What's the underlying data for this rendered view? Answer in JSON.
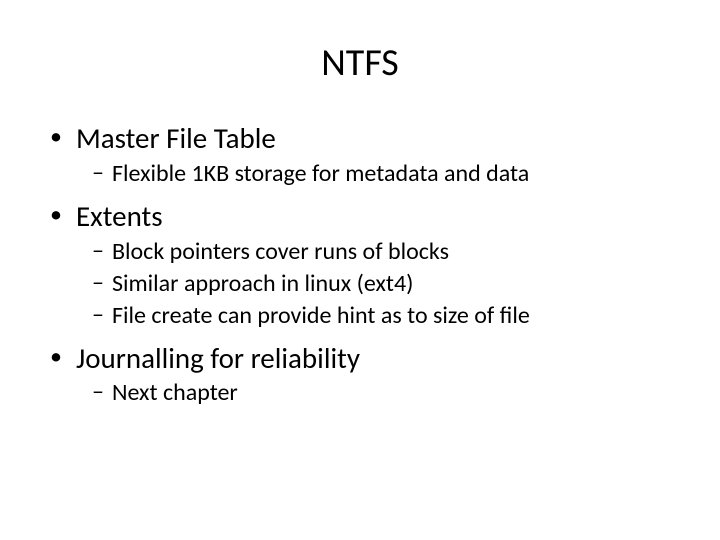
{
  "title": "NTFS",
  "items": [
    {
      "label": "Master File Table",
      "subitems": [
        "Flexible 1KB storage for metadata and data"
      ]
    },
    {
      "label": "Extents",
      "subitems": [
        "Block pointers cover runs of blocks",
        "Similar approach in linux (ext4)",
        "File create can provide hint as to size of file"
      ]
    },
    {
      "label": "Journalling for reliability",
      "subitems": [
        "Next chapter"
      ]
    }
  ]
}
